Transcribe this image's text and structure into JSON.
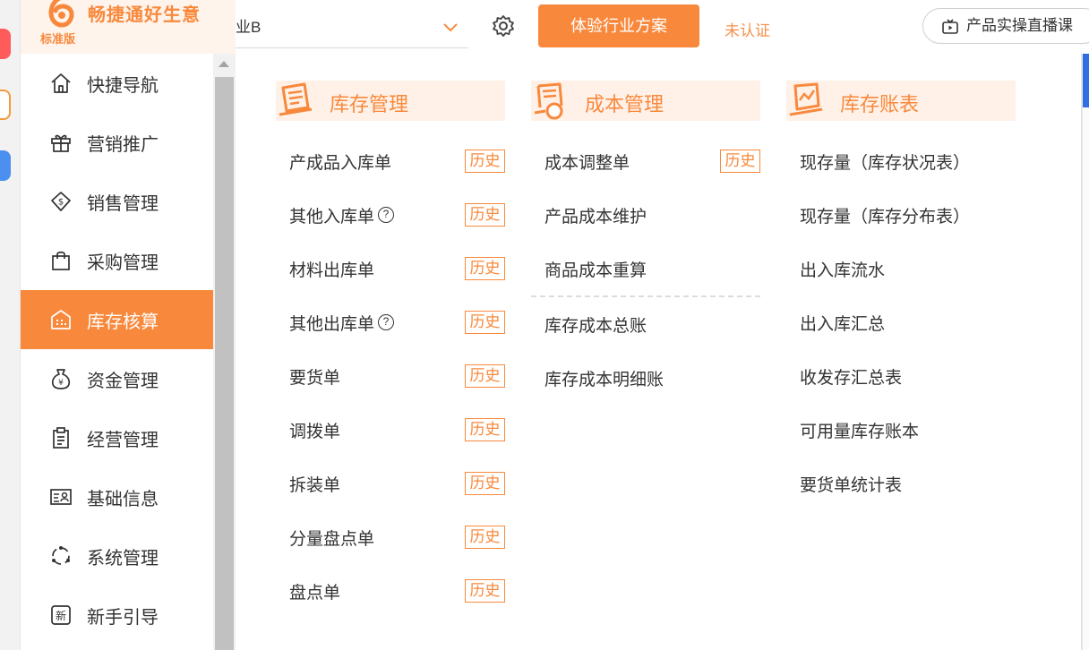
{
  "brand": {
    "name": "畅捷通好生意",
    "edition": "标准版"
  },
  "header": {
    "company_value": "业B",
    "solution_button": "体验行业方案",
    "unverified": "未认证",
    "live_course": "产品实操直播课"
  },
  "sidebar": {
    "items": [
      {
        "label": "快捷导航",
        "icon": "home-icon"
      },
      {
        "label": "营销推广",
        "icon": "gift-icon"
      },
      {
        "label": "销售管理",
        "icon": "sales-tag-icon"
      },
      {
        "label": "采购管理",
        "icon": "shopping-bag-icon"
      },
      {
        "label": "库存核算",
        "icon": "warehouse-icon",
        "active": true
      },
      {
        "label": "资金管理",
        "icon": "money-bag-icon"
      },
      {
        "label": "经营管理",
        "icon": "clipboard-icon"
      },
      {
        "label": "基础信息",
        "icon": "id-card-icon"
      },
      {
        "label": "系统管理",
        "icon": "system-icon"
      },
      {
        "label": "新手引导",
        "icon": "new-guide-icon"
      }
    ]
  },
  "columns": [
    {
      "title": "库存管理",
      "icon": "inventory-doc-icon",
      "items": [
        {
          "label": "产成品入库单",
          "history": "历史"
        },
        {
          "label": "其他入库单",
          "help": "?",
          "history": "历史"
        },
        {
          "label": "材料出库单",
          "history": "历史"
        },
        {
          "label": "其他出库单",
          "help": "?",
          "history": "历史"
        },
        {
          "label": "要货单",
          "history": "历史"
        },
        {
          "label": "调拨单",
          "history": "历史"
        },
        {
          "label": "拆装单",
          "history": "历史"
        },
        {
          "label": "分量盘点单",
          "history": "历史"
        },
        {
          "label": "盘点单",
          "history": "历史"
        }
      ]
    },
    {
      "title": "成本管理",
      "icon": "cost-search-icon",
      "items": [
        {
          "label": "成本调整单",
          "history": "历史"
        },
        {
          "label": "产品成本维护"
        },
        {
          "label": "商品成本重算"
        },
        {
          "label": "库存成本总账",
          "divider_before": true
        },
        {
          "label": "库存成本明细账"
        }
      ]
    },
    {
      "title": "库存账表",
      "icon": "report-chart-icon",
      "items": [
        {
          "label": "现存量（库存状况表）"
        },
        {
          "label": "现存量（库存分布表）"
        },
        {
          "label": "出入库流水"
        },
        {
          "label": "出入库汇总"
        },
        {
          "label": "收发存汇总表"
        },
        {
          "label": "可用量库存账本"
        },
        {
          "label": "要货单统计表"
        }
      ]
    }
  ]
}
